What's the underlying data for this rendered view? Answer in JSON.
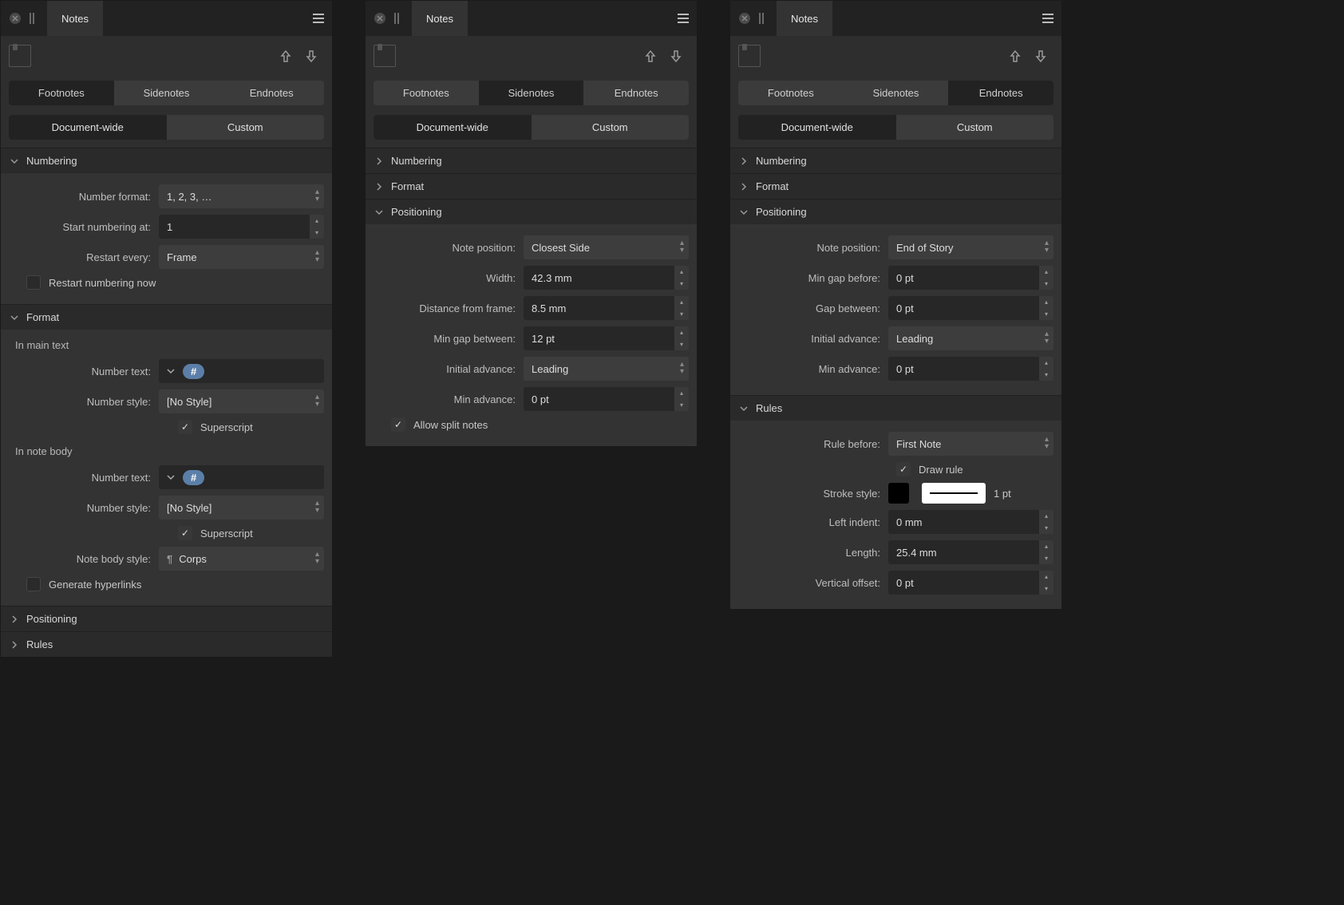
{
  "panels": [
    {
      "title": "Notes",
      "note_types": [
        "Footnotes",
        "Sidenotes",
        "Endnotes"
      ],
      "active_type": 0,
      "scopes": [
        "Document-wide",
        "Custom"
      ],
      "active_scope": 0,
      "sections": {
        "numbering": {
          "title": "Numbering",
          "number_format_label": "Number format:",
          "number_format_value": "1, 2, 3, …",
          "start_at_label": "Start numbering at:",
          "start_at_value": "1",
          "restart_every_label": "Restart every:",
          "restart_every_value": "Frame",
          "restart_now": "Restart numbering now"
        },
        "format": {
          "title": "Format",
          "in_main_text": "In main text",
          "in_note_body": "In note body",
          "number_text_label": "Number text:",
          "number_text_token": "#",
          "number_style_label": "Number style:",
          "number_style_value": "[No Style]",
          "superscript": "Superscript",
          "note_body_style_label": "Note body style:",
          "note_body_style_value": "Corps",
          "generate_hyperlinks": "Generate hyperlinks"
        },
        "positioning": {
          "title": "Positioning"
        },
        "rules": {
          "title": "Rules"
        }
      }
    },
    {
      "title": "Notes",
      "note_types": [
        "Footnotes",
        "Sidenotes",
        "Endnotes"
      ],
      "active_type": 1,
      "scopes": [
        "Document-wide",
        "Custom"
      ],
      "active_scope": 0,
      "sections": {
        "numbering": {
          "title": "Numbering"
        },
        "format": {
          "title": "Format"
        },
        "positioning": {
          "title": "Positioning",
          "note_position_label": "Note position:",
          "note_position_value": "Closest Side",
          "width_label": "Width:",
          "width_value": "42.3 mm",
          "distance_label": "Distance from frame:",
          "distance_value": "8.5 mm",
          "min_gap_label": "Min gap between:",
          "min_gap_value": "12 pt",
          "initial_adv_label": "Initial advance:",
          "initial_adv_value": "Leading",
          "min_adv_label": "Min advance:",
          "min_adv_value": "0 pt",
          "allow_split": "Allow split notes"
        }
      }
    },
    {
      "title": "Notes",
      "note_types": [
        "Footnotes",
        "Sidenotes",
        "Endnotes"
      ],
      "active_type": 2,
      "scopes": [
        "Document-wide",
        "Custom"
      ],
      "active_scope": 0,
      "sections": {
        "numbering": {
          "title": "Numbering"
        },
        "format": {
          "title": "Format"
        },
        "positioning": {
          "title": "Positioning",
          "note_position_label": "Note position:",
          "note_position_value": "End of Story",
          "min_gap_before_label": "Min gap before:",
          "min_gap_before_value": "0 pt",
          "gap_between_label": "Gap between:",
          "gap_between_value": "0 pt",
          "initial_adv_label": "Initial advance:",
          "initial_adv_value": "Leading",
          "min_adv_label": "Min advance:",
          "min_adv_value": "0 pt"
        },
        "rules": {
          "title": "Rules",
          "rule_before_label": "Rule before:",
          "rule_before_value": "First Note",
          "draw_rule": "Draw rule",
          "stroke_style_label": "Stroke style:",
          "stroke_weight": "1 pt",
          "left_indent_label": "Left indent:",
          "left_indent_value": "0 mm",
          "length_label": "Length:",
          "length_value": "25.4 mm",
          "vertical_offset_label": "Vertical offset:",
          "vertical_offset_value": "0 pt",
          "stroke_color": "#000000"
        }
      }
    }
  ]
}
